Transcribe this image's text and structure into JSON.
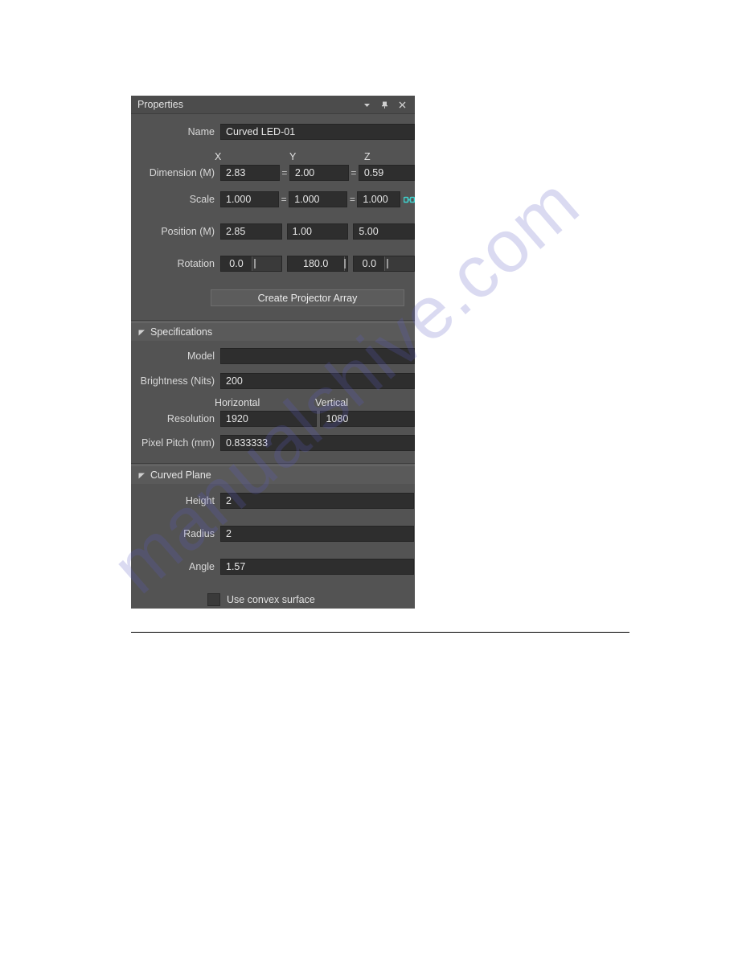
{
  "panel": {
    "title": "Properties",
    "titlebar_icons": [
      {
        "name": "chevron-down-icon",
        "glyph": "chevron-down"
      },
      {
        "name": "pin-icon",
        "glyph": "pin"
      },
      {
        "name": "close-icon",
        "glyph": "close"
      }
    ],
    "name_row": {
      "label": "Name",
      "value": "Curved LED-01"
    },
    "axis_headers": {
      "x": "X",
      "y": "Y",
      "z": "Z"
    },
    "dimension": {
      "label": "Dimension (M)",
      "separator": "=",
      "x": "2.83",
      "y": "2.00",
      "z": "0.59"
    },
    "scale": {
      "label": "Scale",
      "separator": "=",
      "x": "1.000",
      "y": "1.000",
      "z": "1.000",
      "link_icon": "chain-link-icon",
      "link_color": "#3fd0cc"
    },
    "position": {
      "label": "Position (M)",
      "x": "2.85",
      "y": "1.00",
      "z": "5.00"
    },
    "rotation": {
      "label": "Rotation",
      "x": "0.0",
      "y": "180.0",
      "z": "0.0"
    },
    "create_projector_array_button": "Create Projector Array"
  },
  "specifications": {
    "header": "Specifications",
    "model": {
      "label": "Model",
      "value": ""
    },
    "brightness": {
      "label": "Brightness (Nits)",
      "value": "200"
    },
    "resolution": {
      "label": "Resolution",
      "horizontal_header": "Horizontal",
      "vertical_header": "Vertical",
      "horizontal": "1920",
      "vertical": "1080"
    },
    "pixel_pitch": {
      "label": "Pixel Pitch (mm)",
      "value": "0.833333"
    }
  },
  "curved_plane": {
    "header": "Curved Plane",
    "height": {
      "label": "Height",
      "value": "2"
    },
    "radius": {
      "label": "Radius",
      "value": "2"
    },
    "angle": {
      "label": "Angle",
      "value": "1.57"
    },
    "use_convex_surface": {
      "label": "Use convex surface",
      "checked": false
    }
  },
  "watermark": {
    "text": "manualshive.com",
    "color": "#5b5bc4"
  }
}
